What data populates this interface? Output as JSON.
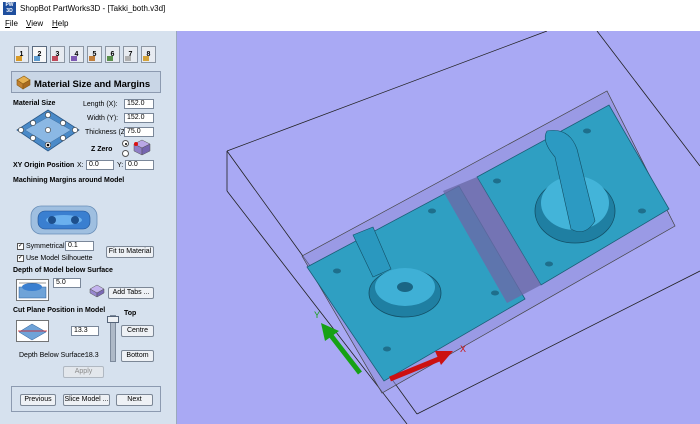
{
  "window": {
    "title": "ShopBot PartWorks3D - [Takki_both.v3d]",
    "app_icon_text": "PW 3D"
  },
  "menu": {
    "items": [
      {
        "label": "File",
        "u": "F",
        "rest": "ile"
      },
      {
        "label": "View",
        "u": "V",
        "rest": "iew"
      },
      {
        "label": "Help",
        "u": "H",
        "rest": "elp"
      }
    ]
  },
  "steps": [
    "1",
    "2",
    "3",
    "4",
    "5",
    "6",
    "7",
    "8"
  ],
  "active_step": 2,
  "panel": {
    "header_title": "Material Size and Margins",
    "material_size_label": "Material Size",
    "length_label": "Length (X):",
    "length_value": "152.0",
    "width_label": "Width (Y):",
    "width_value": "152.0",
    "thickness_label": "Thickness (Z):",
    "thickness_value": "75.0",
    "z_zero_label": "Z Zero",
    "xy_origin_label": "XY Origin Position",
    "x_label": "X:",
    "x_value": "0.0",
    "y_label": "Y:",
    "y_value": "0.0",
    "margins_label": "Machining Margins around Model",
    "symmetrical_label": "Symmetrical",
    "margin_value": "0.1",
    "fit_button": "Fit to Material",
    "silhouette_label": "Use Model Silhouette",
    "depth_label": "Depth of Model below Surface",
    "depth_value": "5.0",
    "add_tabs_button": "Add Tabs ...",
    "cut_plane_label": "Cut Plane Position in Model",
    "top_label": "Top",
    "cut_value": "13.3",
    "centre_button": "Centre",
    "bottom_button": "Bottom",
    "depth_below_label": "Depth Below Surface:",
    "depth_below_value": "18.3",
    "apply_button": "Apply",
    "previous_button": "Previous",
    "slice_button": "Slice Model ...",
    "next_button": "Next"
  },
  "axes": {
    "x_label": "X",
    "y_label": "Y"
  },
  "colors": {
    "panel_bg": "#d6e1ee",
    "viewport_bg": "#a9a9f4",
    "model": "#2f9fc2",
    "x_axis": "#cc1111",
    "y_axis": "#16a116"
  }
}
